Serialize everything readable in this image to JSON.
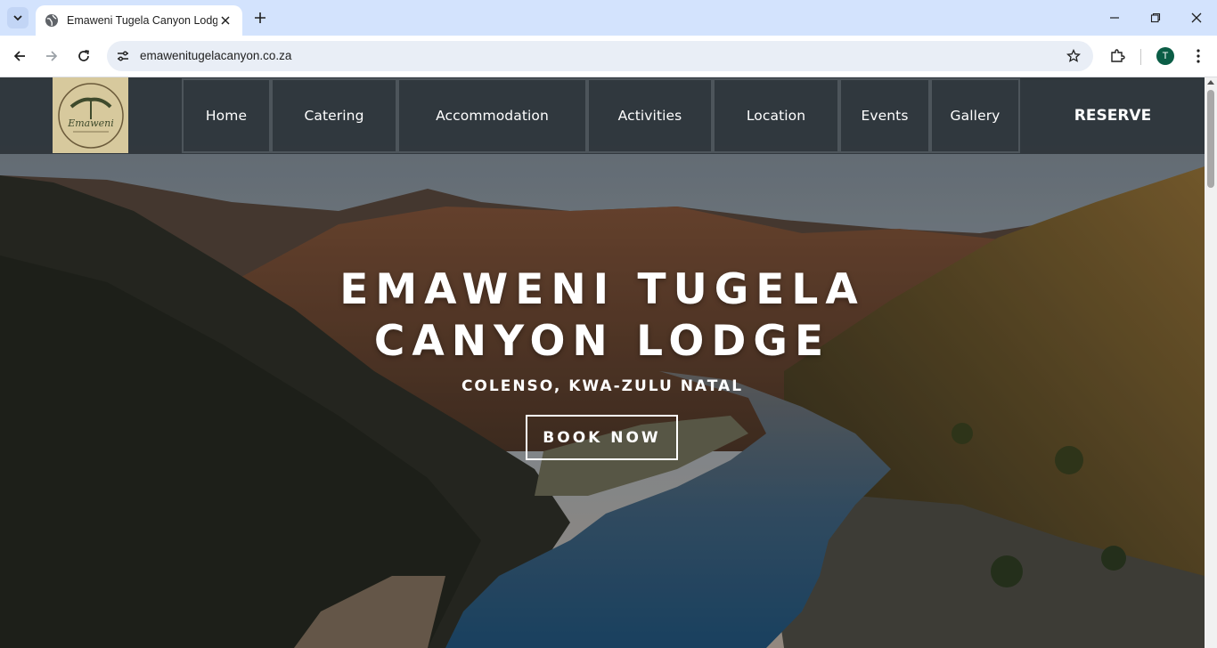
{
  "browser": {
    "tab_title": "Emaweni Tugela Canyon Lodge",
    "url": "emawenitugelacanyon.co.za",
    "profile_initial": "T"
  },
  "site": {
    "logo_text": "Emaweni",
    "nav": [
      {
        "label": "Home"
      },
      {
        "label": "Catering"
      },
      {
        "label": "Accommodation"
      },
      {
        "label": "Activities"
      },
      {
        "label": "Location"
      },
      {
        "label": "Events"
      },
      {
        "label": "Gallery"
      }
    ],
    "reserve_label": "RESERVE"
  },
  "hero": {
    "title_line1": "EMAWENI TUGELA",
    "title_line2": "CANYON LODGE",
    "subtitle": "COLENSO, KWA-ZULU NATAL",
    "cta": "BOOK NOW"
  },
  "colors": {
    "header_bg": "#2c343a",
    "tabbar_bg": "#d3e3fd",
    "avatar_bg": "#0b5d46"
  }
}
